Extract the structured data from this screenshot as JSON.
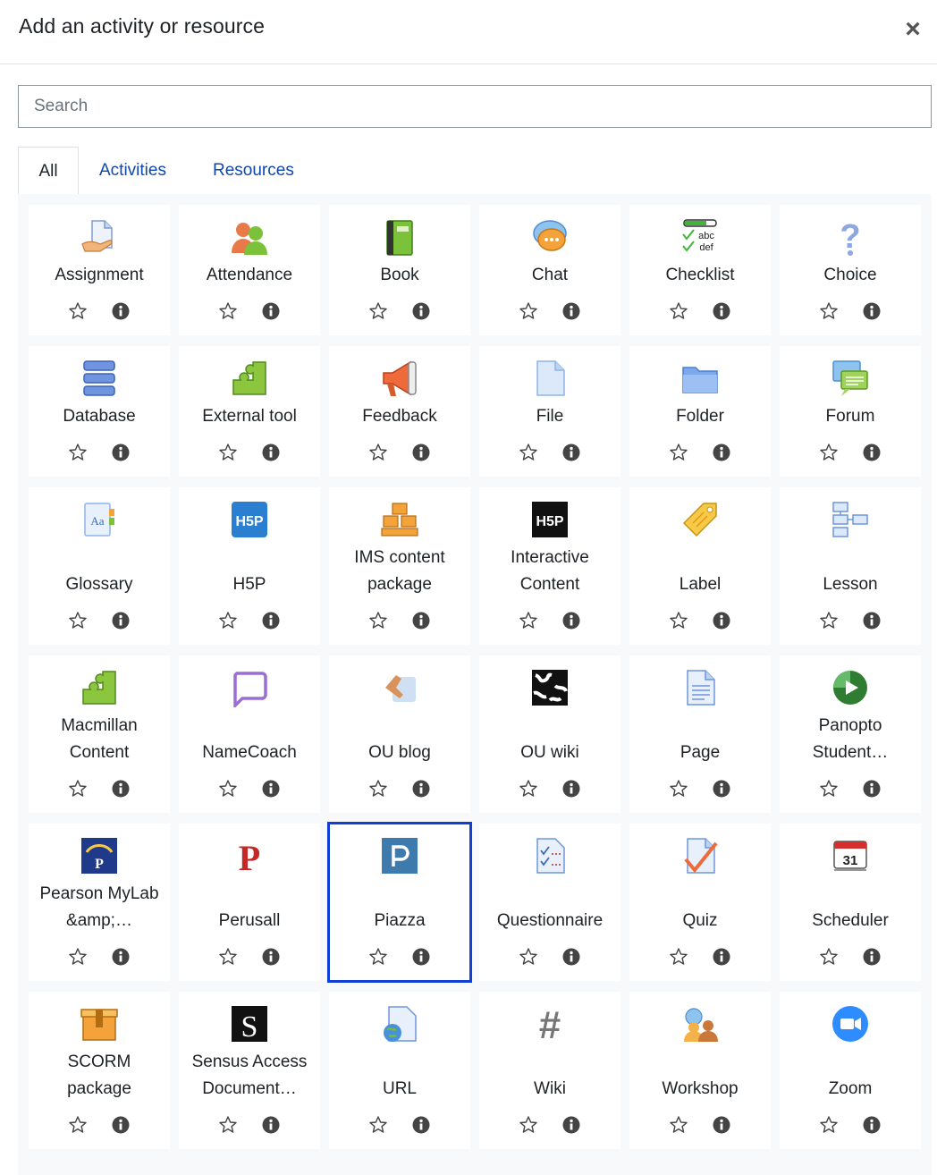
{
  "dialog": {
    "title": "Add an activity or resource",
    "close_label": "×"
  },
  "search": {
    "placeholder": "Search",
    "value": ""
  },
  "tabs": [
    {
      "label": "All",
      "active": true
    },
    {
      "label": "Activities",
      "active": false
    },
    {
      "label": "Resources",
      "active": false
    }
  ],
  "colors": {
    "link": "#0f47ad",
    "selected_outline": "#0f3fd6",
    "panel_bg": "#f8f9fa"
  },
  "items": [
    {
      "label": "Assignment",
      "label2": "",
      "icon": "assignment-icon",
      "selected": false
    },
    {
      "label": "Attendance",
      "label2": "",
      "icon": "attendance-icon",
      "selected": false
    },
    {
      "label": "Book",
      "label2": "",
      "icon": "book-icon",
      "selected": false
    },
    {
      "label": "Chat",
      "label2": "",
      "icon": "chat-icon",
      "selected": false
    },
    {
      "label": "Checklist",
      "label2": "",
      "icon": "checklist-icon",
      "selected": false
    },
    {
      "label": "Choice",
      "label2": "",
      "icon": "choice-icon",
      "selected": false
    },
    {
      "label": "Database",
      "label2": "",
      "icon": "database-icon",
      "selected": false
    },
    {
      "label": "External tool",
      "label2": "",
      "icon": "external-tool-icon",
      "selected": false
    },
    {
      "label": "Feedback",
      "label2": "",
      "icon": "feedback-icon",
      "selected": false
    },
    {
      "label": "File",
      "label2": "",
      "icon": "file-icon",
      "selected": false
    },
    {
      "label": "Folder",
      "label2": "",
      "icon": "folder-icon",
      "selected": false
    },
    {
      "label": "Forum",
      "label2": "",
      "icon": "forum-icon",
      "selected": false
    },
    {
      "label": "Glossary",
      "label2": "",
      "icon": "glossary-icon",
      "selected": false
    },
    {
      "label": "H5P",
      "label2": "",
      "icon": "h5p-icon",
      "selected": false
    },
    {
      "label": "IMS content",
      "label2": "package",
      "icon": "ims-package-icon",
      "selected": false
    },
    {
      "label": "Interactive",
      "label2": "Content",
      "icon": "interactive-content-icon",
      "selected": false
    },
    {
      "label": "Label",
      "label2": "",
      "icon": "label-icon",
      "selected": false
    },
    {
      "label": "Lesson",
      "label2": "",
      "icon": "lesson-icon",
      "selected": false
    },
    {
      "label": "Macmillan",
      "label2": "Content",
      "icon": "macmillan-icon",
      "selected": false
    },
    {
      "label": "NameCoach",
      "label2": "",
      "icon": "namecoach-icon",
      "selected": false
    },
    {
      "label": "OU blog",
      "label2": "",
      "icon": "ou-blog-icon",
      "selected": false
    },
    {
      "label": "OU wiki",
      "label2": "",
      "icon": "ou-wiki-icon",
      "selected": false
    },
    {
      "label": "Page",
      "label2": "",
      "icon": "page-icon",
      "selected": false
    },
    {
      "label": "Panopto",
      "label2": "Student…",
      "icon": "panopto-icon",
      "selected": false
    },
    {
      "label": "Pearson MyLab",
      "label2": "&amp;…",
      "icon": "pearson-icon",
      "selected": false
    },
    {
      "label": "Perusall",
      "label2": "",
      "icon": "perusall-icon",
      "selected": false
    },
    {
      "label": "Piazza",
      "label2": "",
      "icon": "piazza-icon",
      "selected": true
    },
    {
      "label": "Questionnaire",
      "label2": "",
      "icon": "questionnaire-icon",
      "selected": false
    },
    {
      "label": "Quiz",
      "label2": "",
      "icon": "quiz-icon",
      "selected": false
    },
    {
      "label": "Scheduler",
      "label2": "",
      "icon": "scheduler-icon",
      "selected": false
    },
    {
      "label": "SCORM",
      "label2": "package",
      "icon": "scorm-icon",
      "selected": false
    },
    {
      "label": "Sensus Access",
      "label2": "Document…",
      "icon": "sensus-icon",
      "selected": false
    },
    {
      "label": "URL",
      "label2": "",
      "icon": "url-icon",
      "selected": false
    },
    {
      "label": "Wiki",
      "label2": "",
      "icon": "wiki-icon",
      "selected": false
    },
    {
      "label": "Workshop",
      "label2": "",
      "icon": "workshop-icon",
      "selected": false
    },
    {
      "label": "Zoom",
      "label2": "",
      "icon": "zoom-icon",
      "selected": false
    }
  ],
  "icon_glyphs": {
    "h5p": "H5P",
    "interactive": "H5P",
    "checklist_line1": "abc",
    "checklist_line2": "def",
    "choice": "?",
    "glossary": "Aa",
    "perusall": "P",
    "sensus": "S",
    "scheduler": "31",
    "wiki": "#"
  }
}
